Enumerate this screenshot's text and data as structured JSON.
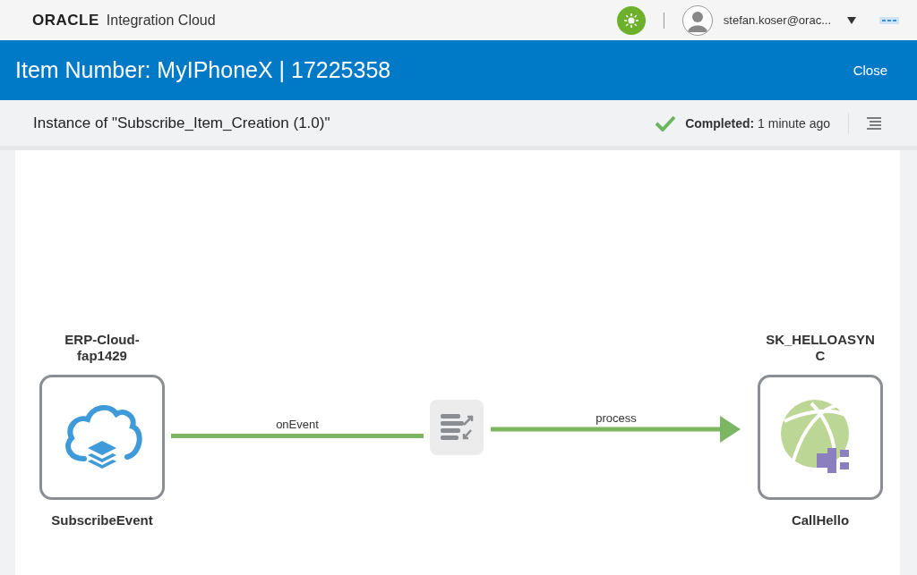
{
  "header": {
    "brand": "ORACLE",
    "product": "Integration Cloud",
    "user": "stefan.koser@orac..."
  },
  "title_bar": {
    "title": "Item Number: MyIPhoneX | 17225358",
    "close": "Close"
  },
  "sub_header": {
    "instance": "Instance of \"Subscribe_Item_Creation (1.0)\"",
    "status": {
      "kind": "completed",
      "label": "Completed:",
      "time": "1 minute ago"
    }
  },
  "flow": {
    "nodes": [
      {
        "kind": "source",
        "connection": "ERP-Cloud-fap1429",
        "name": "SubscribeEvent"
      },
      {
        "kind": "target",
        "connection": "SK_HELLOASYNC",
        "name": "CallHello"
      }
    ],
    "edges": [
      {
        "label": "onEvent"
      },
      {
        "label": "process"
      }
    ]
  }
}
